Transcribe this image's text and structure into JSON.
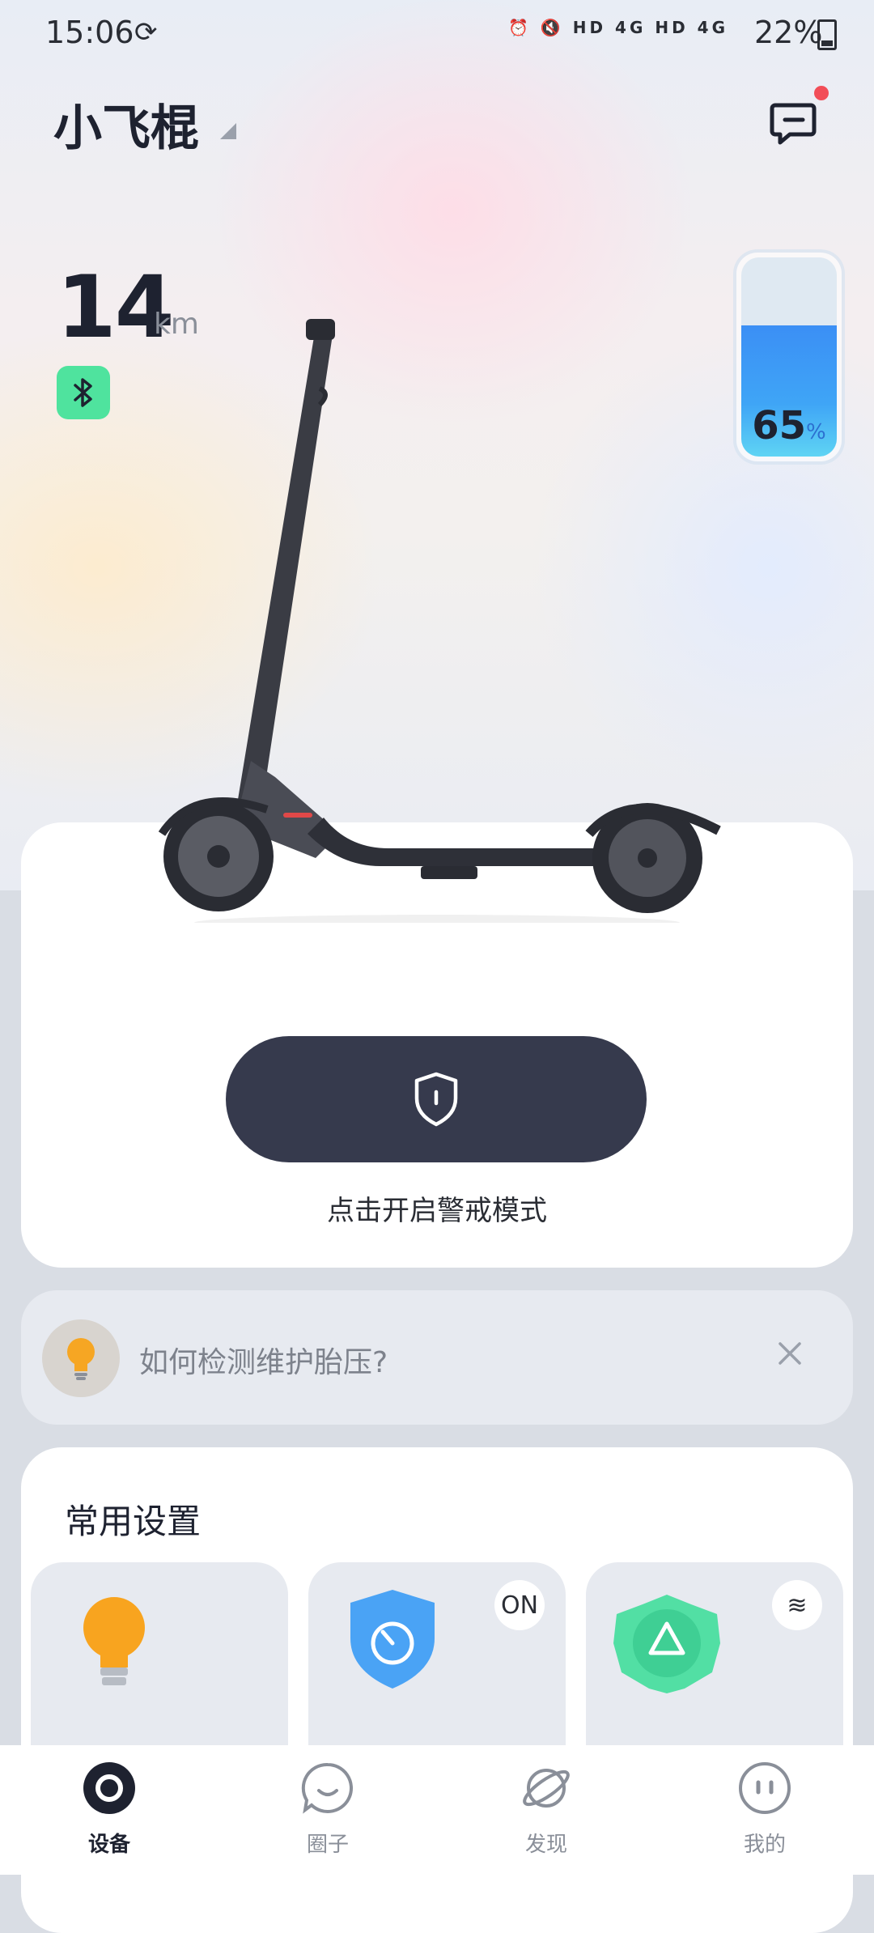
{
  "status_bar": {
    "time": "15:06",
    "network_text": "HD 4G HD 4G",
    "battery_text": "22%"
  },
  "header": {
    "device_name": "小飞棍",
    "message_icon": "message-icon",
    "has_unread": true
  },
  "dashboard": {
    "distance_value": "14",
    "distance_unit": "km",
    "bluetooth_icon": "bluetooth-icon",
    "battery_level_percent": 65,
    "battery_value": "65",
    "battery_unit": "%"
  },
  "alarm": {
    "icon": "shield-icon",
    "label": "点击开启警戒模式"
  },
  "tip": {
    "icon": "lightbulb-icon",
    "text": "如何检测维护胎压?"
  },
  "settings": {
    "title": "常用设置",
    "tiles": [
      {
        "icon": "lightbulb-icon",
        "badge": ""
      },
      {
        "icon": "speed-shield-icon",
        "badge": "ON"
      },
      {
        "icon": "recycle-icon",
        "badge": "≋"
      }
    ]
  },
  "tabs": [
    {
      "label": "设备",
      "icon": "device-icon",
      "active": true
    },
    {
      "label": "圈子",
      "icon": "circle-chat-icon",
      "active": false
    },
    {
      "label": "发现",
      "icon": "planet-icon",
      "active": false
    },
    {
      "label": "我的",
      "icon": "profile-icon",
      "active": false
    }
  ],
  "colors": {
    "accent_dark": "#363a4d",
    "bluetooth_green": "#4fe39e",
    "battery_blue": "#3b8ff5",
    "notify_red": "#f24d57"
  }
}
